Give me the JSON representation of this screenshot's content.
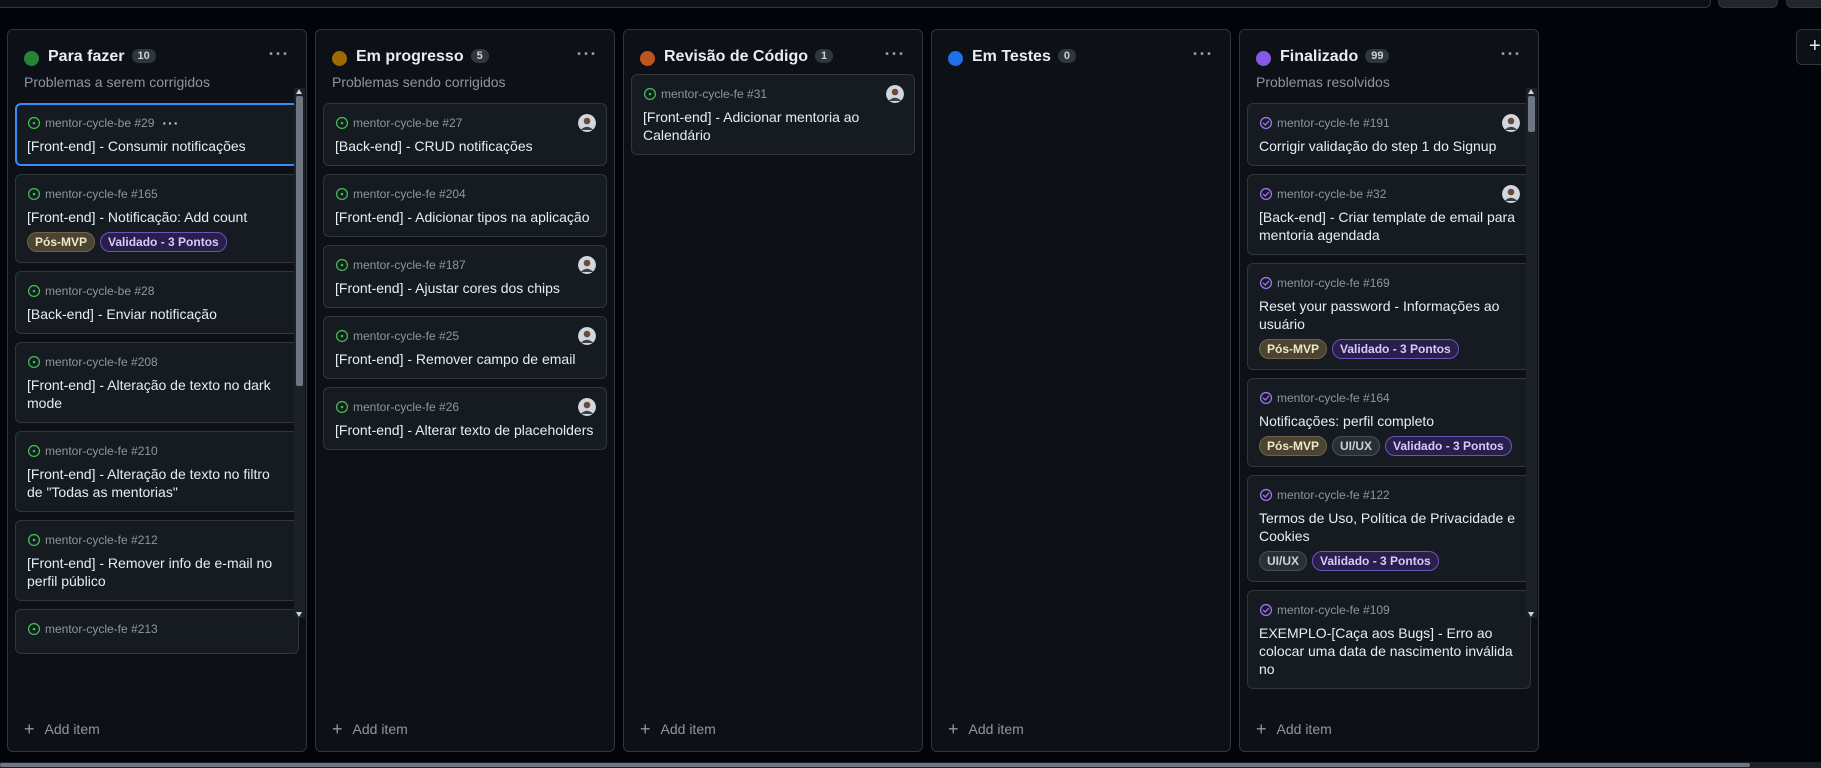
{
  "columns": [
    {
      "title": "Para fazer",
      "count": "10",
      "dot_color": "#238636",
      "description": "Problemas a serem corrigidos",
      "add_label": "Add item",
      "cards": [
        {
          "repo": "mentor-cycle-be #29",
          "title": "[Front-end] - Consumir notificações",
          "labels": [],
          "selected": true,
          "status": "open"
        },
        {
          "repo": "mentor-cycle-fe #165",
          "title": "[Front-end] - Notificação: Add count",
          "labels": [
            "Pós-MVP",
            "Validado - 3 Pontos"
          ],
          "status": "open"
        },
        {
          "repo": "mentor-cycle-be #28",
          "title": "[Back-end] - Enviar notificação",
          "labels": [],
          "status": "open"
        },
        {
          "repo": "mentor-cycle-fe #208",
          "title": "[Front-end] - Alteração de texto no dark mode",
          "labels": [],
          "status": "open"
        },
        {
          "repo": "mentor-cycle-fe #210",
          "title": "[Front-end] - Alteração de texto no filtro de \"Todas as mentorias\"",
          "labels": [],
          "status": "open"
        },
        {
          "repo": "mentor-cycle-fe #212",
          "title": "[Front-end] - Remover info de e-mail no perfil público",
          "labels": [],
          "status": "open"
        },
        {
          "repo": "mentor-cycle-fe #213",
          "title": "",
          "labels": [],
          "status": "open"
        }
      ]
    },
    {
      "title": "Em progresso",
      "count": "5",
      "dot_color": "#9e6a03",
      "description": "Problemas sendo corrigidos",
      "add_label": "Add item",
      "cards": [
        {
          "repo": "mentor-cycle-be #27",
          "title": "[Back-end] - CRUD notificações",
          "labels": [],
          "avatar": true,
          "status": "open"
        },
        {
          "repo": "mentor-cycle-fe #204",
          "title": "[Front-end] - Adicionar tipos na aplicação",
          "labels": [],
          "status": "open"
        },
        {
          "repo": "mentor-cycle-fe #187",
          "title": "[Front-end] - Ajustar cores dos chips",
          "labels": [],
          "avatar": true,
          "status": "open"
        },
        {
          "repo": "mentor-cycle-fe #25",
          "title": "[Front-end] - Remover campo de email",
          "labels": [],
          "avatar": true,
          "status": "open"
        },
        {
          "repo": "mentor-cycle-fe #26",
          "title": "[Front-end] - Alterar texto de placeholders",
          "labels": [],
          "avatar": true,
          "status": "open"
        }
      ]
    },
    {
      "title": "Revisão de Código",
      "count": "1",
      "dot_color": "#bd561d",
      "description": "",
      "add_label": "Add item",
      "cards": [
        {
          "repo": "mentor-cycle-fe #31",
          "title": "[Front-end] - Adicionar mentoria ao Calendário",
          "labels": [],
          "avatar": true,
          "status": "open"
        }
      ]
    },
    {
      "title": "Em Testes",
      "count": "0",
      "dot_color": "#1f6feb",
      "description": "",
      "add_label": "Add item",
      "cards": []
    },
    {
      "title": "Finalizado",
      "count": "99",
      "dot_color": "#8957e5",
      "description": "Problemas resolvidos",
      "add_label": "Add item",
      "cards": [
        {
          "repo": "mentor-cycle-fe #191",
          "title": "Corrigir validação do step 1 do Signup",
          "labels": [],
          "avatar": true,
          "status": "done"
        },
        {
          "repo": "mentor-cycle-be #32",
          "title": "[Back-end] - Criar template de email para mentoria agendada",
          "labels": [],
          "avatar": true,
          "status": "done"
        },
        {
          "repo": "mentor-cycle-fe #169",
          "title": "Reset your password - Informações ao usuário",
          "labels": [
            "Pós-MVP",
            "Validado - 3 Pontos"
          ],
          "status": "done"
        },
        {
          "repo": "mentor-cycle-fe #164",
          "title": "Notificações: perfil completo",
          "labels": [
            "Pós-MVP",
            "UI/UX",
            "Validado - 3 Pontos"
          ],
          "status": "done"
        },
        {
          "repo": "mentor-cycle-fe #122",
          "title": "Termos de Uso, Política de Privacidade e Cookies",
          "labels": [
            "UI/UX",
            "Validado - 3 Pontos"
          ],
          "status": "done"
        },
        {
          "repo": "mentor-cycle-fe #109",
          "title": "EXEMPLO-[Caça aos Bugs] - Erro ao colocar uma data de nascimento inválida no",
          "labels": [],
          "status": "done"
        }
      ]
    }
  ],
  "add_column_label": "+",
  "card_menu_label": "···",
  "column_menu_label": "···",
  "colors": {
    "open_icon": "#3fb950",
    "done_icon": "#a371f7",
    "selected_border": "#388bfd"
  }
}
